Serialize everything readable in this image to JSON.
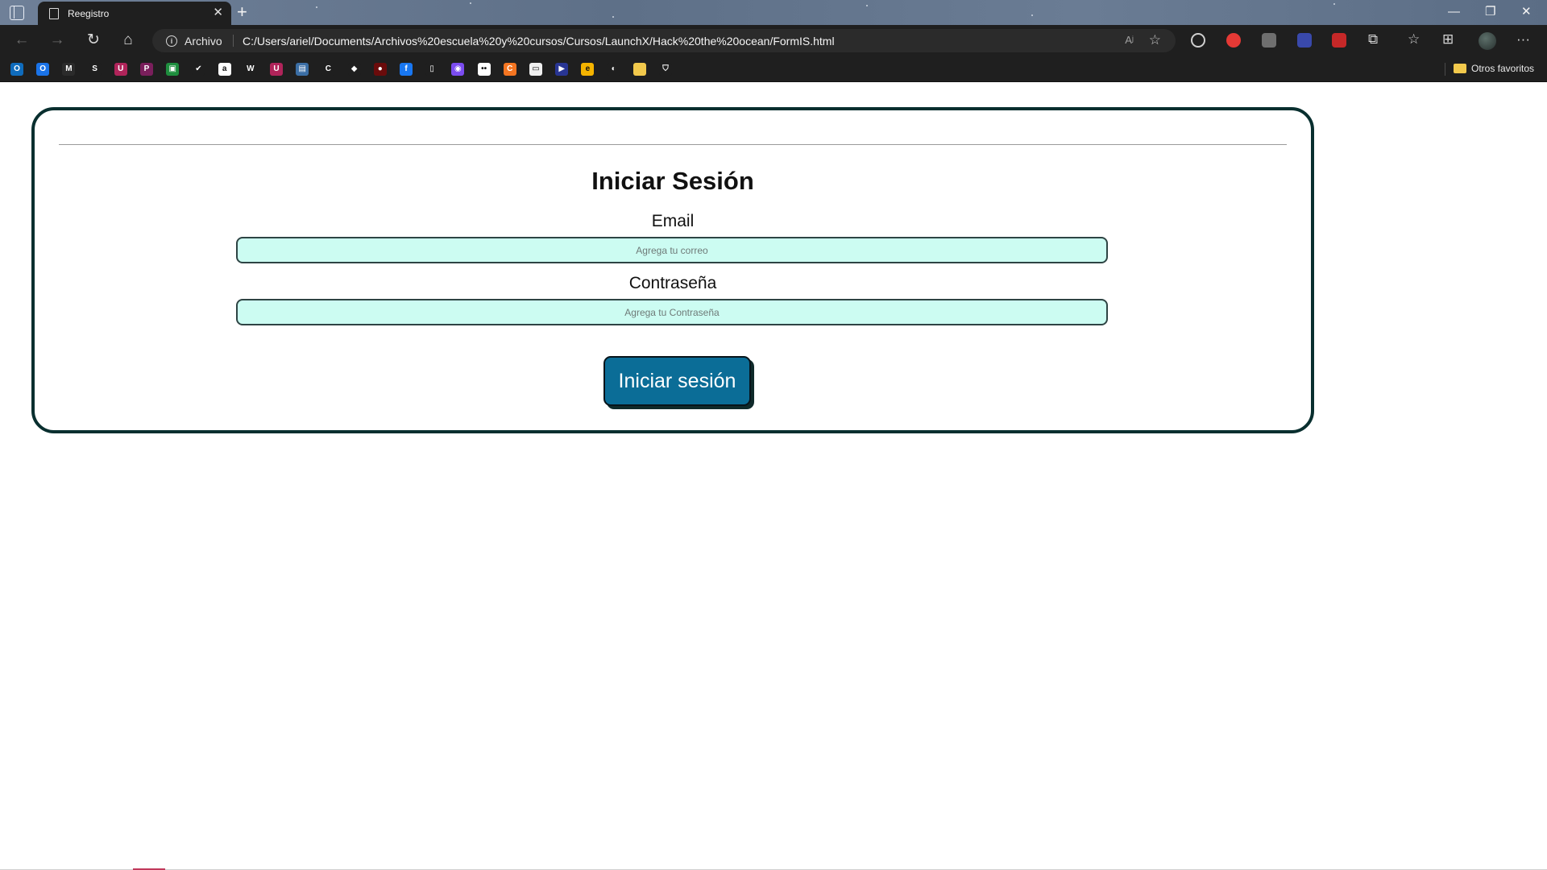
{
  "browser": {
    "tab": {
      "title": "Reegistro",
      "close_glyph": "✕"
    },
    "new_tab_glyph": "+",
    "window_controls": {
      "minimize": "—",
      "restore": "❐",
      "close": "✕"
    },
    "address_bar": {
      "scheme_label": "Archivo",
      "url": "C:/Users/ariel/Documents/Archivos%20escuela%20y%20cursos/Cursos/LaunchX/Hack%20the%20ocean/FormIS.html",
      "read_aloud_glyph": "Aʲ"
    },
    "nav_glyphs": {
      "back": "←",
      "forward": "→",
      "reload": "↻",
      "home": "⌂"
    },
    "toolbar_glyphs": {
      "extensions": "⧉",
      "favorites": "☆",
      "collections": "⊞",
      "more": "···"
    },
    "bookmarks": {
      "other_favorites_label": "Otros favoritos",
      "items": [
        {
          "name": "outlook-bookmark",
          "color": "#0f6cbd",
          "glyph": "O"
        },
        {
          "name": "outlook-bookmark-2",
          "color": "#1a73e8",
          "glyph": "O"
        },
        {
          "name": "gmail-bookmark",
          "color": "#2b2b2b",
          "glyph": "M"
        },
        {
          "name": "s-bookmark",
          "color": "#1f1f1f",
          "glyph": "S"
        },
        {
          "name": "school-bookmark",
          "color": "#b0245a",
          "glyph": "U"
        },
        {
          "name": "plex-bookmark",
          "color": "#7a1f5c",
          "glyph": "P"
        },
        {
          "name": "classroom-bookmark",
          "color": "#1e8e3e",
          "glyph": "▣"
        },
        {
          "name": "todo-bookmark",
          "color": "#1f1f1f",
          "glyph": "✔"
        },
        {
          "name": "amazon-bookmark",
          "color": "#ffffff",
          "glyph": "a"
        },
        {
          "name": "w-bookmark",
          "color": "#1f1f1f",
          "glyph": "W"
        },
        {
          "name": "school-bookmark-2",
          "color": "#b0245a",
          "glyph": "U"
        },
        {
          "name": "meet-bookmark",
          "color": "#3b6ea5",
          "glyph": "▤"
        },
        {
          "name": "c-bookmark",
          "color": "#1f1f1f",
          "glyph": "C"
        },
        {
          "name": "bird-bookmark",
          "color": "#1f1f1f",
          "glyph": "◆"
        },
        {
          "name": "red-dot-bookmark",
          "color": "#6a0b0b",
          "glyph": "●"
        },
        {
          "name": "facebook-bookmark",
          "color": "#1877f2",
          "glyph": "f"
        },
        {
          "name": "doc-bookmark",
          "color": "#1f1f1f",
          "glyph": "▯"
        },
        {
          "name": "messenger-bookmark",
          "color": "#7b4cf0",
          "glyph": "◉"
        },
        {
          "name": "flickr-bookmark",
          "color": "#ffffff",
          "glyph": "••"
        },
        {
          "name": "crunchyroll-bookmark",
          "color": "#f47521",
          "glyph": "C"
        },
        {
          "name": "hbo-bookmark",
          "color": "#f0f0f0",
          "glyph": "▭"
        },
        {
          "name": "video-bookmark",
          "color": "#283593",
          "glyph": "▶"
        },
        {
          "name": "e-bookmark",
          "color": "#f5b400",
          "glyph": "e"
        },
        {
          "name": "github-bookmark",
          "color": "#1f1f1f",
          "glyph": "◐"
        },
        {
          "name": "folder-bookmark",
          "color": "#f2c94c",
          "glyph": ""
        },
        {
          "name": "shield-bookmark",
          "color": "#1f1f1f",
          "glyph": "⛉"
        }
      ]
    }
  },
  "form": {
    "title": "Iniciar Sesión",
    "email": {
      "label": "Email",
      "placeholder": "Agrega tu correo"
    },
    "password": {
      "label": "Contraseña",
      "placeholder": "Agrega tu Contraseña"
    },
    "submit_label": "Iniciar sesión"
  }
}
